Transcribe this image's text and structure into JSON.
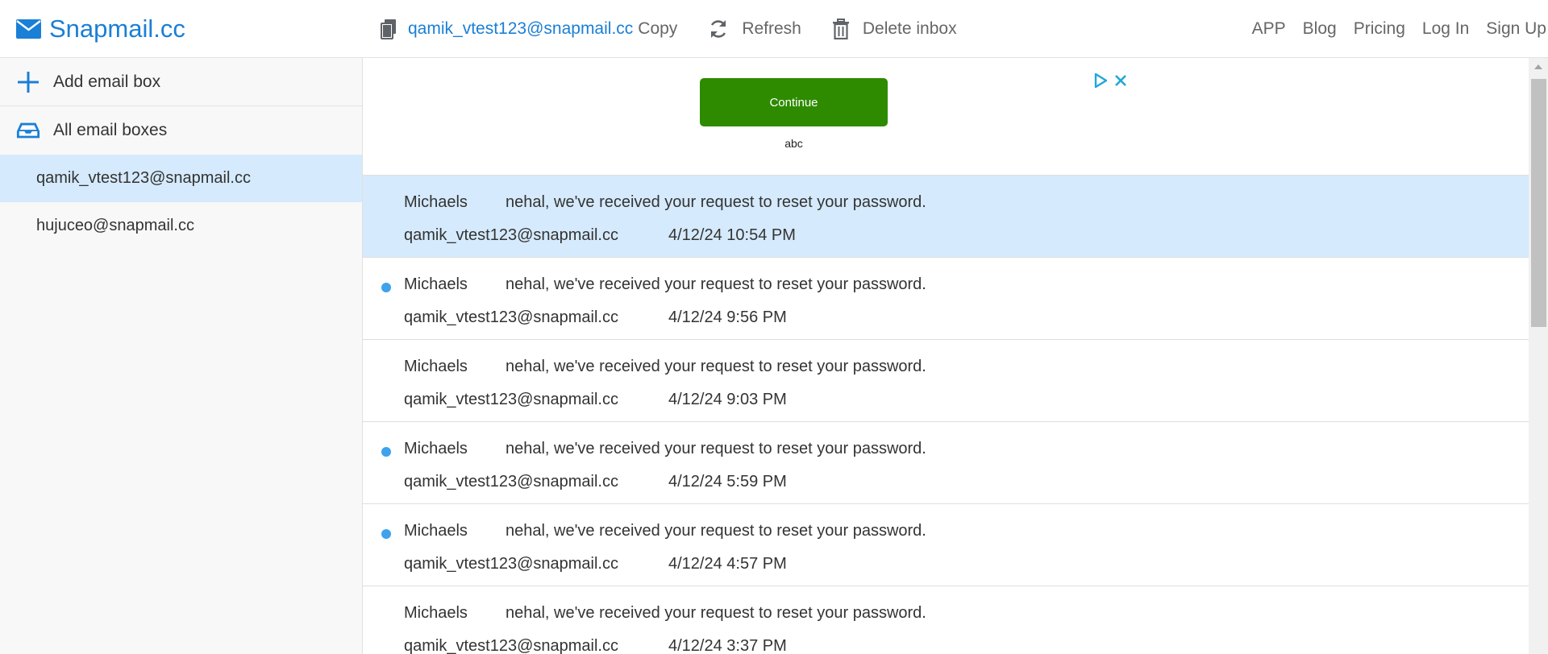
{
  "brand": {
    "name": "Snapmail.cc",
    "color": "#1a7fd6"
  },
  "toolbar": {
    "current_address": "qamik_vtest123@snapmail.cc",
    "copy_label": "Copy",
    "refresh_label": "Refresh",
    "delete_label": "Delete inbox"
  },
  "nav": {
    "items": [
      "APP",
      "Blog",
      "Pricing",
      "Log In",
      "Sign Up"
    ]
  },
  "sidebar": {
    "add_label": "Add email box",
    "all_label": "All email boxes",
    "boxes": [
      {
        "address": "qamik_vtest123@snapmail.cc",
        "selected": true
      },
      {
        "address": "hujuceo@snapmail.cc",
        "selected": false
      }
    ]
  },
  "ad": {
    "button_label": "Continue",
    "caption": "abc",
    "button_color": "#2e8b00"
  },
  "emails": [
    {
      "sender": "Michaels",
      "subject": "nehal, we've received your request to reset your password.",
      "recipient": "qamik_vtest123@snapmail.cc",
      "date": "4/12/24 10:54 PM",
      "unread": false,
      "selected": true
    },
    {
      "sender": "Michaels",
      "subject": "nehal, we've received your request to reset your password.",
      "recipient": "qamik_vtest123@snapmail.cc",
      "date": "4/12/24 9:56 PM",
      "unread": true,
      "selected": false
    },
    {
      "sender": "Michaels",
      "subject": "nehal, we've received your request to reset your password.",
      "recipient": "qamik_vtest123@snapmail.cc",
      "date": "4/12/24 9:03 PM",
      "unread": false,
      "selected": false
    },
    {
      "sender": "Michaels",
      "subject": "nehal, we've received your request to reset your password.",
      "recipient": "qamik_vtest123@snapmail.cc",
      "date": "4/12/24 5:59 PM",
      "unread": true,
      "selected": false
    },
    {
      "sender": "Michaels",
      "subject": "nehal, we've received your request to reset your password.",
      "recipient": "qamik_vtest123@snapmail.cc",
      "date": "4/12/24 4:57 PM",
      "unread": true,
      "selected": false
    },
    {
      "sender": "Michaels",
      "subject": "nehal, we've received your request to reset your password.",
      "recipient": "qamik_vtest123@snapmail.cc",
      "date": "4/12/24 3:37 PM",
      "unread": false,
      "selected": false
    }
  ],
  "colors": {
    "accent": "#1a7fd6",
    "selected_row": "#d5eafc",
    "unread_dot": "#3ea2ec"
  },
  "icons": {
    "brand": "envelope-icon",
    "copy": "copy-icon",
    "refresh": "refresh-icon",
    "delete": "trash-icon",
    "add": "plus-icon",
    "all": "inbox-icon",
    "ad_play": "ad-choices-icon",
    "ad_close": "close-icon"
  }
}
